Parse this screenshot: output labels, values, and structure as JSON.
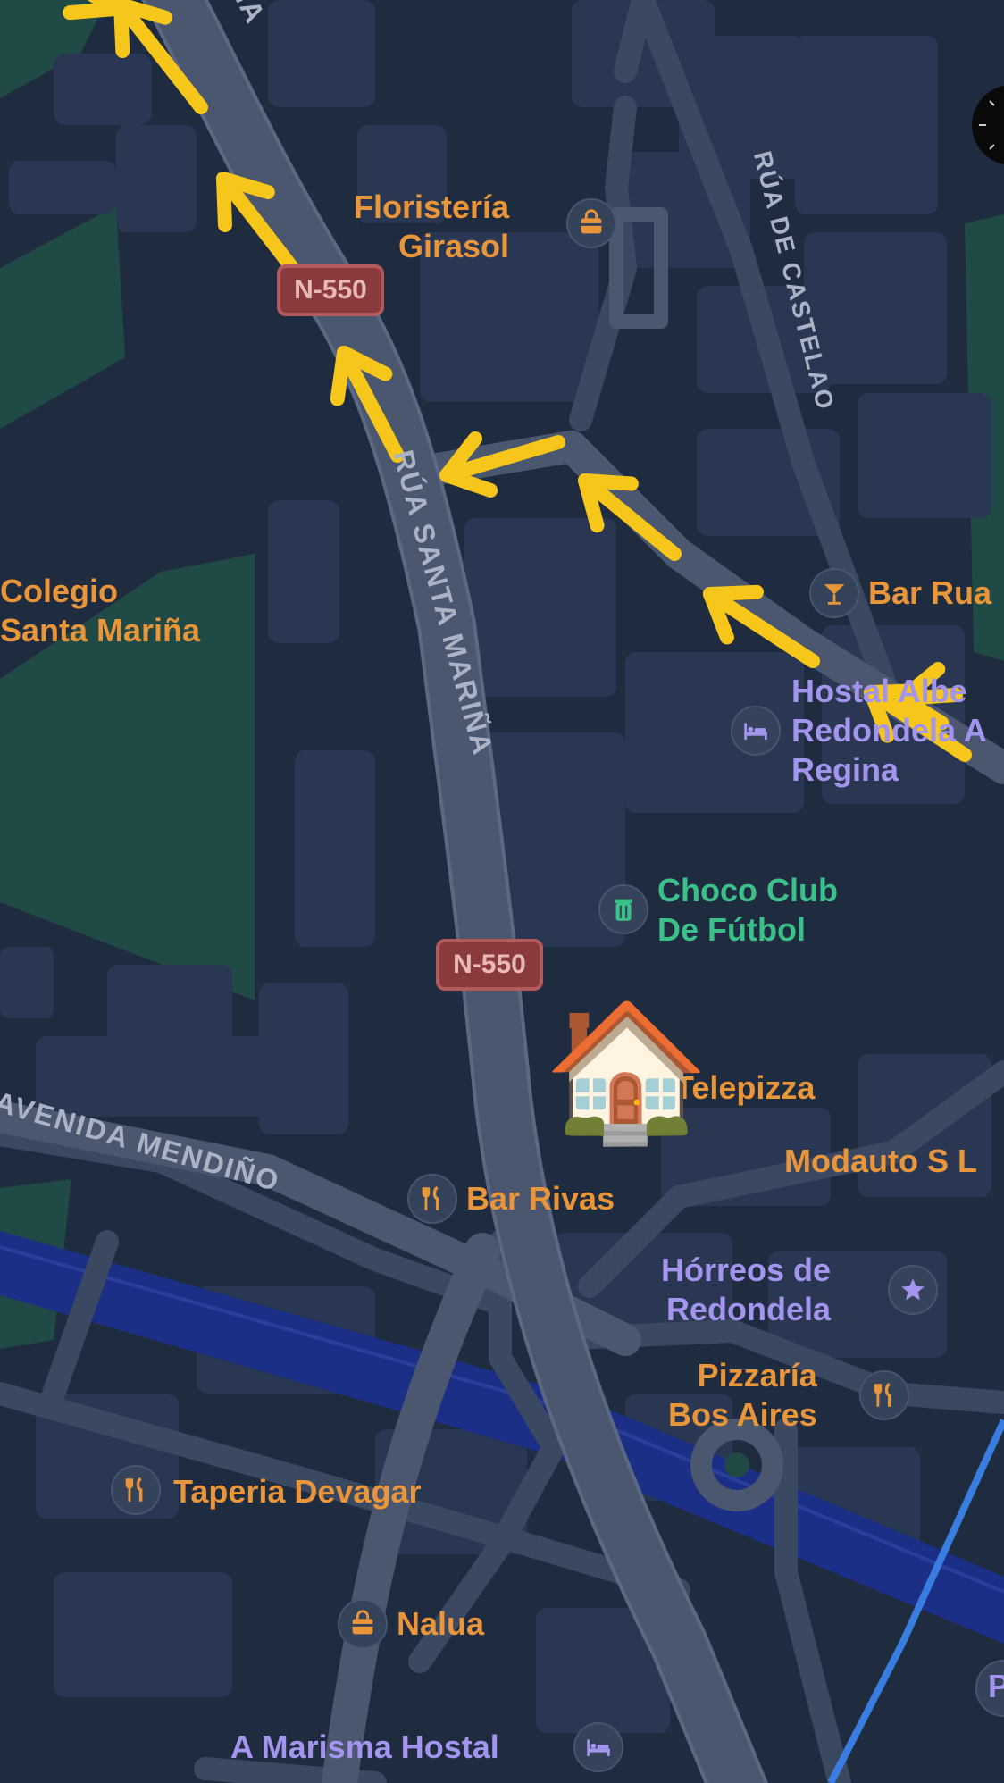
{
  "map": {
    "colors": {
      "background": "#1f2b3f",
      "block": "#2a3752",
      "road": "#4a576f",
      "road_edge": "#5b6882",
      "green": "#1f4a46",
      "water": "#1c2f87",
      "route_arrow": "#f6c61a",
      "transit_line": "#3a7de0",
      "label_orange": "#e9953a",
      "label_purple": "#a395ee",
      "label_green": "#3cc08a"
    },
    "road_shields": [
      {
        "id": "n550-top",
        "label": "N-550"
      },
      {
        "id": "n550-mid",
        "label": "N-550"
      }
    ],
    "streets": {
      "santa_marina_main": "RÚA SANTA MARIÑA",
      "santa_marina_top": "RÚA SANTA MARIÑA",
      "castelao": "RÚA DE CASTELAO",
      "mendino": "AVENIDA MENDIÑO"
    },
    "pois": {
      "floristeria": {
        "name": "Floristería\nGirasol",
        "icon": "shopping-bag-icon"
      },
      "colegio": {
        "name": "Colegio\nSanta Mariña"
      },
      "bar_rua": {
        "name": "Bar Rua",
        "icon": "cocktail-icon"
      },
      "hostal_alberto": {
        "name": "Hostal Albe\nRedondela A\nRegina",
        "icon": "bed-icon"
      },
      "choco_club": {
        "name": "Choco Club\nDe Fútbol",
        "icon": "trash-bin-icon"
      },
      "telepizza": {
        "name": "Telepizza"
      },
      "modauto": {
        "name": "Modauto S L"
      },
      "bar_rivas": {
        "name": "Bar Rivas",
        "icon": "restaurant-icon"
      },
      "horreos": {
        "name": "Hórreos de\nRedondela",
        "icon": "star-icon"
      },
      "pizzaria": {
        "name": "Pizzaría\nBos Aires",
        "icon": "restaurant-icon"
      },
      "taperia": {
        "name": "Taperia Devagar",
        "icon": "restaurant-icon"
      },
      "nalua": {
        "name": "Nalua",
        "icon": "shopping-bag-icon"
      },
      "marisma": {
        "name": "A Marisma Hostal",
        "icon": "bed-icon"
      },
      "partial_p": {
        "name": "P"
      }
    },
    "home_marker": {
      "emoji": "🏠",
      "icon": "house-icon"
    },
    "route": {
      "arrow_count": 9,
      "direction": "north-west"
    }
  }
}
